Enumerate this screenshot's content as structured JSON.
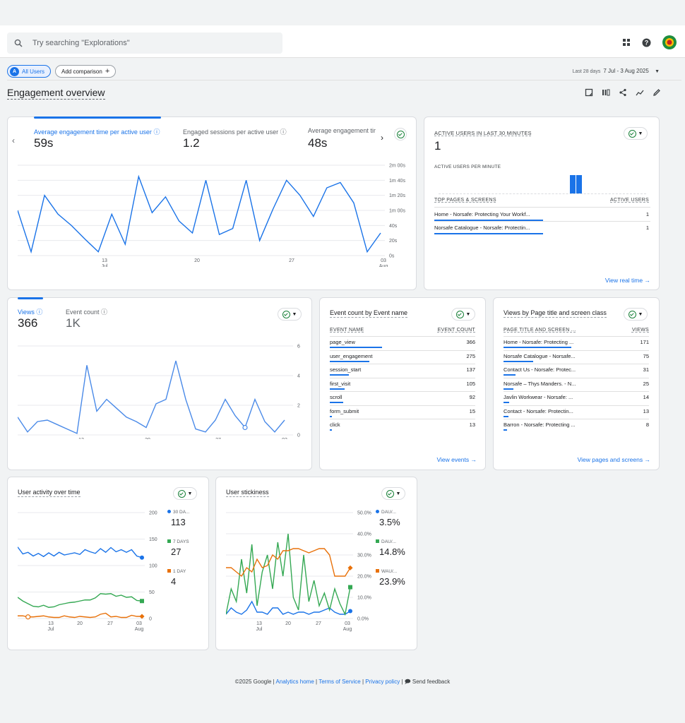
{
  "search": {
    "placeholder": "Try searching \"Explorations\""
  },
  "filters": {
    "segment_badge": "A",
    "segment": "All Users",
    "add_comparison": "Add comparison"
  },
  "date": {
    "label": "Last 28 days",
    "range": "7 Jul - 3 Aug 2025"
  },
  "page_title": "Engagement overview",
  "engagement": {
    "metrics": [
      {
        "label": "Average engagement time per active user",
        "value": "59s"
      },
      {
        "label": "Engaged sessions per active user",
        "value": "1.2"
      },
      {
        "label": "Average engagement tir",
        "value": "48s"
      }
    ],
    "y_ticks": [
      "2m 00s",
      "1m 40s",
      "1m 20s",
      "1m 00s",
      "40s",
      "20s",
      "0s"
    ],
    "x_ticks": [
      {
        "d": "13",
        "m": "Jul"
      },
      {
        "d": "20",
        "m": ""
      },
      {
        "d": "27",
        "m": ""
      },
      {
        "d": "03",
        "m": "Aug"
      }
    ]
  },
  "realtime": {
    "header": "ACTIVE USERS IN LAST 30 MINUTES",
    "value": "1",
    "per_minute": "ACTIVE USERS PER MINUTE",
    "col1": "TOP PAGES & SCREENS",
    "col2": "ACTIVE USERS",
    "rows": [
      {
        "name": "Home - Norsafe: Protecting Your Workf...",
        "value": "1"
      },
      {
        "name": "Norsafe Catalogue - Norsafe: Protectin...",
        "value": "1"
      }
    ],
    "link": "View real time"
  },
  "views_card": {
    "metrics": [
      {
        "label": "Views",
        "value": "366"
      },
      {
        "label": "Event count",
        "value": "1K"
      }
    ],
    "y_ticks": [
      "60",
      "40",
      "20",
      "0"
    ],
    "x_ticks": [
      {
        "d": "13",
        "m": "Jul"
      },
      {
        "d": "20",
        "m": ""
      },
      {
        "d": "27",
        "m": ""
      },
      {
        "d": "03",
        "m": "Aug"
      }
    ]
  },
  "events_card": {
    "title": "Event count by Event name",
    "col1": "EVENT NAME",
    "col2": "EVENT COUNT",
    "rows": [
      {
        "name": "page_view",
        "value": "366",
        "frac": 1.0
      },
      {
        "name": "user_engagement",
        "value": "275",
        "frac": 0.75
      },
      {
        "name": "session_start",
        "value": "137",
        "frac": 0.37
      },
      {
        "name": "first_visit",
        "value": "105",
        "frac": 0.29
      },
      {
        "name": "scroll",
        "value": "92",
        "frac": 0.25
      },
      {
        "name": "form_submit",
        "value": "15",
        "frac": 0.04
      },
      {
        "name": "click",
        "value": "13",
        "frac": 0.035
      }
    ],
    "link": "View events"
  },
  "pages_card": {
    "title": "Views by Page title and screen class",
    "col1": "PAGE TITLE AND SCREEN ...",
    "col2": "VIEWS",
    "rows": [
      {
        "name": "Home - Norsafe: Protecting ...",
        "value": "171",
        "frac": 1.0
      },
      {
        "name": "Norsafe Catalogue - Norsafe...",
        "value": "75",
        "frac": 0.44
      },
      {
        "name": "Contact Us - Norsafe: Protec...",
        "value": "31",
        "frac": 0.18
      },
      {
        "name": "Norsafe – Thys Manders. - N...",
        "value": "25",
        "frac": 0.15
      },
      {
        "name": "Javlin Workwear - Norsafe: ...",
        "value": "14",
        "frac": 0.08
      },
      {
        "name": "Contact - Norsafe: Protectin...",
        "value": "13",
        "frac": 0.076
      },
      {
        "name": "Barron - Norsafe: Protecting ...",
        "value": "8",
        "frac": 0.047
      }
    ],
    "link": "View pages and screens"
  },
  "activity_card": {
    "title": "User activity over time",
    "y_ticks": [
      "200",
      "150",
      "100",
      "50",
      "0"
    ],
    "x_ticks": [
      {
        "d": "13",
        "m": "Jul"
      },
      {
        "d": "20",
        "m": ""
      },
      {
        "d": "27",
        "m": ""
      },
      {
        "d": "03",
        "m": "Aug"
      }
    ],
    "legend": [
      {
        "label": "30 DA...",
        "value": "113",
        "color": "#1a73e8"
      },
      {
        "label": "7 DAYS",
        "value": "27",
        "color": "#34a853"
      },
      {
        "label": "1 DAY",
        "value": "4",
        "color": "#e8710a"
      }
    ]
  },
  "sticky_card": {
    "title": "User stickiness",
    "y_ticks": [
      "50.0%",
      "40.0%",
      "30.0%",
      "20.0%",
      "10.0%",
      "0.0%"
    ],
    "x_ticks": [
      {
        "d": "13",
        "m": "Jul"
      },
      {
        "d": "20",
        "m": ""
      },
      {
        "d": "27",
        "m": ""
      },
      {
        "d": "03",
        "m": "Aug"
      }
    ],
    "legend": [
      {
        "label": "DAU/...",
        "value": "3.5%",
        "color": "#1a73e8"
      },
      {
        "label": "DAU/...",
        "value": "14.8%",
        "color": "#34a853"
      },
      {
        "label": "WAU/...",
        "value": "23.9%",
        "color": "#e8710a"
      }
    ]
  },
  "footer": {
    "copyright": "©2025 Google |",
    "analytics_home": "Analytics home",
    "terms": "Terms of Service",
    "privacy": "Privacy policy",
    "feedback": "Send feedback"
  },
  "colors": {
    "accent": "#1a73e8",
    "green": "#34a853",
    "orange": "#e8710a"
  }
}
